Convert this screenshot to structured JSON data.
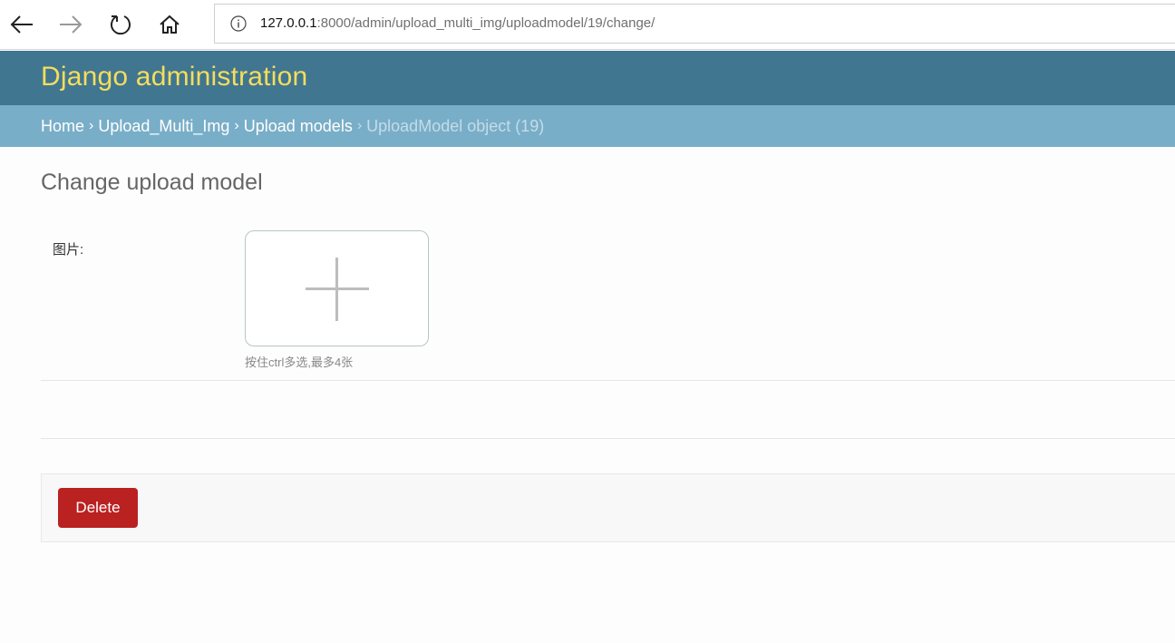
{
  "browser": {
    "url_host": "127.0.0.1",
    "url_rest": ":8000/admin/upload_multi_img/uploadmodel/19/change/",
    "icons": [
      "back-arrow-icon",
      "forward-arrow-icon",
      "refresh-icon",
      "home-icon",
      "info-icon"
    ]
  },
  "header": {
    "branding": "Django administration"
  },
  "breadcrumbs": {
    "home": "Home",
    "app": "Upload_Multi_Img",
    "model": "Upload models",
    "current": "UploadModel object (19)",
    "separator": "›"
  },
  "content": {
    "title": "Change upload model",
    "field_label": "图片:",
    "help_text": "按住ctrl多选,最多4张"
  },
  "submit_row": {
    "delete_label": "Delete"
  },
  "colors": {
    "header_bg": "#417690",
    "branding": "#f5dd5d",
    "breadcrumb_bg": "#79aec8",
    "delete_bg": "#ba2121"
  }
}
